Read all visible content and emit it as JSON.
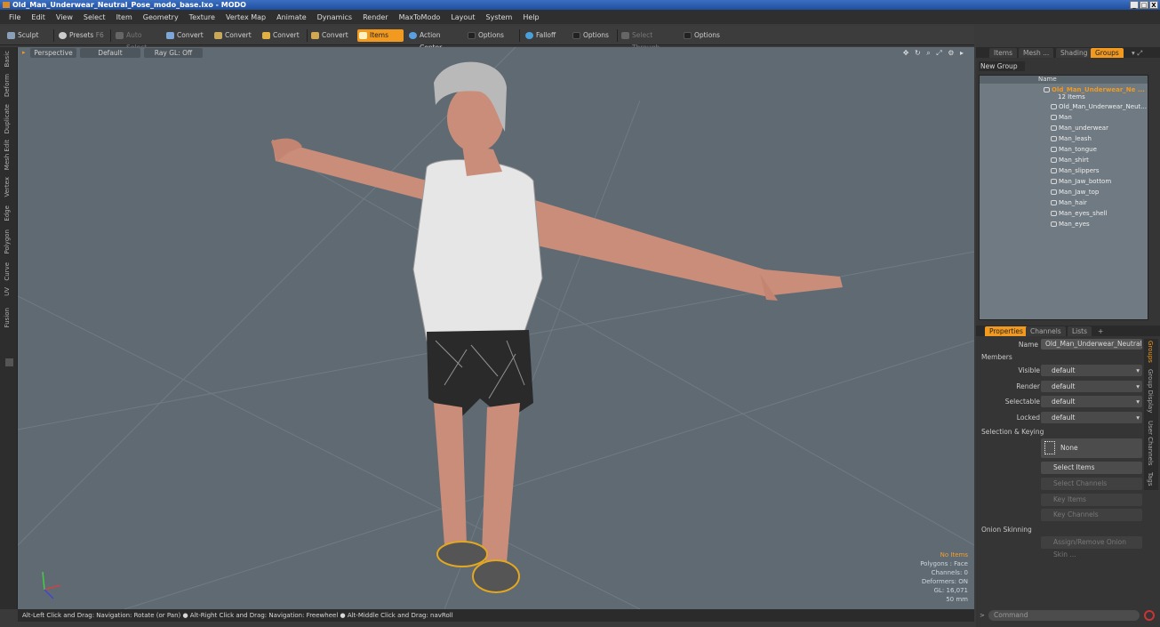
{
  "window": {
    "title": "Old_Man_Underwear_Neutral_Pose_modo_base.lxo - MODO",
    "controls": [
      "_",
      "□",
      "X"
    ]
  },
  "menu": [
    "File",
    "Edit",
    "View",
    "Select",
    "Item",
    "Geometry",
    "Texture",
    "Vertex Map",
    "Animate",
    "Dynamics",
    "Render",
    "MaxToModo",
    "Layout",
    "System",
    "Help"
  ],
  "toolbar": {
    "sculpt": "Sculpt",
    "presets": "Presets",
    "presets_key": "F6",
    "auto_select": "Auto Select",
    "convert1": "Convert",
    "convert2": "Convert",
    "convert3": "Convert",
    "convert4": "Convert",
    "items": "Items",
    "action_center": "Action Center",
    "options1": "Options",
    "falloff": "Falloff",
    "options2": "Options",
    "select_through": "Select Through",
    "options3": "Options"
  },
  "left_tabs": [
    "Basic",
    "Deform",
    "Duplicate",
    "Mesh Edit",
    "Vertex",
    "Edge",
    "Polygon",
    "Curve",
    "UV",
    "Fusion"
  ],
  "viewport": {
    "view": "Perspective",
    "shading": "Default",
    "raygl": "Ray GL: Off",
    "hud": {
      "no_items": "No Items",
      "polygons": "Polygons : Face",
      "channels": "Channels: 0",
      "deformers": "Deformers: ON",
      "gl": "GL: 16,071",
      "scale": "50 mm"
    }
  },
  "status": "Alt-Left Click and Drag: Navigation: Rotate (or Pan) ● Alt-Right Click and Drag: Navigation: Freewheel ● Alt-Middle Click and Drag: navRoll",
  "right_tabs": {
    "items": "Items",
    "mesh": "Mesh ...",
    "shading": "Shading",
    "groups": "Groups"
  },
  "groups": {
    "new_group": "New Group",
    "name_header": "Name",
    "root": "Old_Man_Underwear_Ne ...",
    "count": "12 Items",
    "items": [
      "Old_Man_Underwear_Neut...",
      "Man",
      "Man_underwear",
      "Man_leash",
      "Man_tongue",
      "Man_shirt",
      "Man_slippers",
      "Man_Jaw_bottom",
      "Man_Jaw_top",
      "Man_hair",
      "Man_eyes_shell",
      "Man_eyes"
    ]
  },
  "properties": {
    "tabs": [
      "Properties",
      "Channels",
      "Lists",
      "+"
    ],
    "name_label": "Name",
    "name_value": "Old_Man_Underwear_Neutral_Po",
    "members": "Members",
    "visible_label": "Visible",
    "visible": "default",
    "render_label": "Render",
    "render": "default",
    "selectable_label": "Selectable",
    "selectable": "default",
    "locked_label": "Locked",
    "locked": "default",
    "sel_keying": "Selection & Keying",
    "none": "None",
    "select_items": "Select Items",
    "select_channels": "Select Channels",
    "key_items": "Key Items",
    "key_channels": "Key Channels",
    "onion": "Onion Skinning",
    "assign_onion": "Assign/Remove Onion Skin ..."
  },
  "side_tabs": [
    "Groups",
    "Group Display",
    "User Channels",
    "Tags"
  ],
  "command": "Command"
}
